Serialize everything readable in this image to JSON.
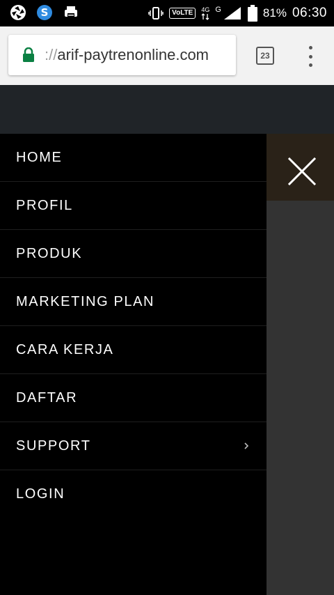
{
  "status_bar": {
    "left_icons": [
      "aperture-icon",
      "s-app-icon",
      "printer-icon"
    ],
    "network": {
      "volte": "VoLTE",
      "lte": "4G",
      "g": "G"
    },
    "battery": "81%",
    "time": "06:30"
  },
  "browser": {
    "url_scheme": "://",
    "url_host": "arif-paytrenonline.com",
    "tab_count": "23"
  },
  "menu": {
    "items": [
      {
        "label": "HOME"
      },
      {
        "label": "PROFIL"
      },
      {
        "label": "PRODUK"
      },
      {
        "label": "MARKETING PLAN"
      },
      {
        "label": "CARA KERJA"
      },
      {
        "label": "DAFTAR"
      },
      {
        "label": "SUPPORT",
        "has_submenu": true
      },
      {
        "label": "LOGIN"
      }
    ]
  },
  "colors": {
    "drawer_bg": "#000000",
    "lock_green": "#0b8043"
  }
}
